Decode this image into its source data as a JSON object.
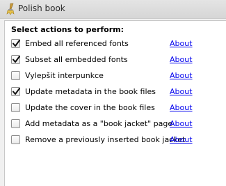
{
  "window": {
    "title": "Polish book"
  },
  "panel": {
    "heading": "Select actions to perform:"
  },
  "actions": [
    {
      "label": "Embed all referenced fonts",
      "checked": true,
      "about": "About"
    },
    {
      "label": "Subset all embedded fonts",
      "checked": true,
      "about": "About"
    },
    {
      "label": "Vylepšit interpunkce",
      "checked": false,
      "about": "About"
    },
    {
      "label": "Update metadata in the book files",
      "checked": true,
      "about": "About"
    },
    {
      "label": "Update the cover in the book files",
      "checked": false,
      "about": "About"
    },
    {
      "label": "Add metadata as a \"book jacket\" page",
      "checked": false,
      "about": "About"
    },
    {
      "label": "Remove a previously inserted book jacket",
      "checked": false,
      "about": "About"
    }
  ],
  "icons": {
    "title": "brush-icon",
    "check": "checkmark-icon"
  },
  "colors": {
    "link": "#0000ee",
    "panel_background": "#ffffff",
    "window_background": "#f0f0f0"
  }
}
